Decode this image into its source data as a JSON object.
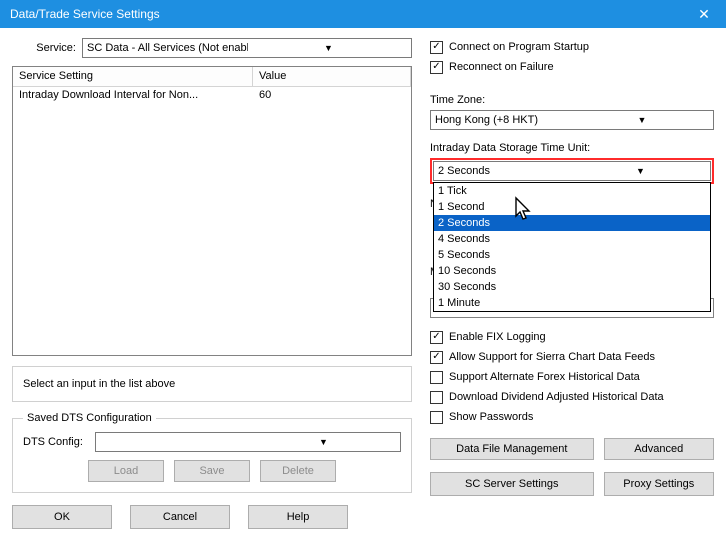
{
  "window": {
    "title": "Data/Trade Service Settings"
  },
  "service": {
    "label": "Service:",
    "value": "SC Data - All Services (Not enabled on packa"
  },
  "table": {
    "headers": {
      "setting": "Service Setting",
      "value": "Value"
    },
    "rows": [
      {
        "setting": "Intraday Download Interval for Non...",
        "value": "60"
      }
    ]
  },
  "hint": "Select an input in the list above",
  "dts": {
    "legend": "Saved DTS Configuration",
    "label": "DTS Config:",
    "value": "",
    "buttons": {
      "load": "Load",
      "save": "Save",
      "delete": "Delete"
    }
  },
  "footer": {
    "ok": "OK",
    "cancel": "Cancel",
    "help": "Help"
  },
  "right": {
    "connect": "Connect on Program Startup",
    "reconnect": "Reconnect on Failure",
    "tz_label": "Time Zone:",
    "tz_value": "Hong Kong (+8 HKT)",
    "storage_label": "Intraday Data Storage Time Unit:",
    "storage_value": "2 Seconds",
    "storage_options": [
      "1 Tick",
      "1 Second",
      "2 Seconds",
      "4 Seconds",
      "5 Seconds",
      "10 Seconds",
      "30 Seconds",
      "1 Minute"
    ],
    "obscured1": "Nu",
    "obscured2": "M",
    "fix": "Enable FIX Logging",
    "allow": "Allow Support for Sierra Chart Data Feeds",
    "forex": "Support Alternate Forex Historical Data",
    "div": "Download Dividend Adjusted Historical Data",
    "pw": "Show Passwords",
    "datafile": "Data File Management",
    "advanced": "Advanced",
    "scserver": "SC Server Settings",
    "proxy": "Proxy Settings"
  }
}
